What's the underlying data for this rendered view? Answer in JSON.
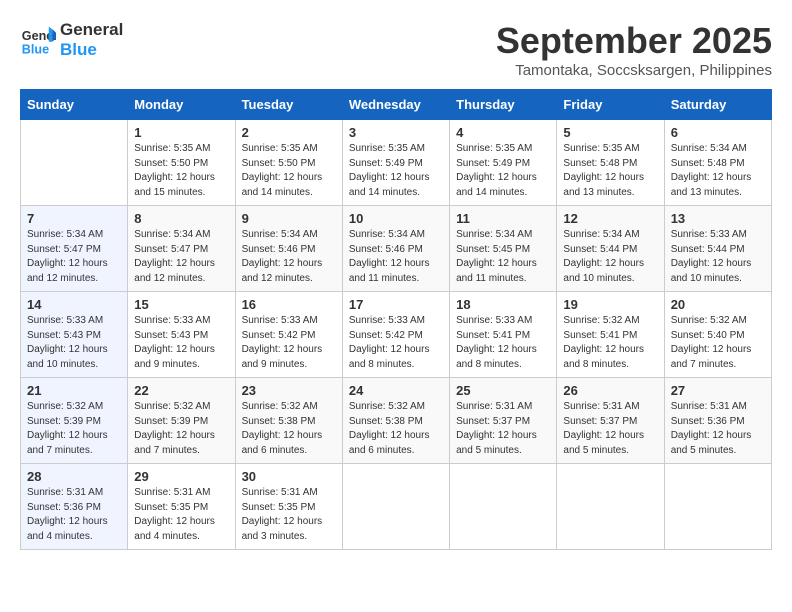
{
  "logo": {
    "line1": "General",
    "line2": "Blue"
  },
  "title": "September 2025",
  "location": "Tamontaka, Soccsksargen, Philippines",
  "weekdays": [
    "Sunday",
    "Monday",
    "Tuesday",
    "Wednesday",
    "Thursday",
    "Friday",
    "Saturday"
  ],
  "weeks": [
    [
      {
        "day": "",
        "detail": ""
      },
      {
        "day": "1",
        "detail": "Sunrise: 5:35 AM\nSunset: 5:50 PM\nDaylight: 12 hours\nand 15 minutes."
      },
      {
        "day": "2",
        "detail": "Sunrise: 5:35 AM\nSunset: 5:50 PM\nDaylight: 12 hours\nand 14 minutes."
      },
      {
        "day": "3",
        "detail": "Sunrise: 5:35 AM\nSunset: 5:49 PM\nDaylight: 12 hours\nand 14 minutes."
      },
      {
        "day": "4",
        "detail": "Sunrise: 5:35 AM\nSunset: 5:49 PM\nDaylight: 12 hours\nand 14 minutes."
      },
      {
        "day": "5",
        "detail": "Sunrise: 5:35 AM\nSunset: 5:48 PM\nDaylight: 12 hours\nand 13 minutes."
      },
      {
        "day": "6",
        "detail": "Sunrise: 5:34 AM\nSunset: 5:48 PM\nDaylight: 12 hours\nand 13 minutes."
      }
    ],
    [
      {
        "day": "7",
        "detail": "Sunrise: 5:34 AM\nSunset: 5:47 PM\nDaylight: 12 hours\nand 12 minutes."
      },
      {
        "day": "8",
        "detail": "Sunrise: 5:34 AM\nSunset: 5:47 PM\nDaylight: 12 hours\nand 12 minutes."
      },
      {
        "day": "9",
        "detail": "Sunrise: 5:34 AM\nSunset: 5:46 PM\nDaylight: 12 hours\nand 12 minutes."
      },
      {
        "day": "10",
        "detail": "Sunrise: 5:34 AM\nSunset: 5:46 PM\nDaylight: 12 hours\nand 11 minutes."
      },
      {
        "day": "11",
        "detail": "Sunrise: 5:34 AM\nSunset: 5:45 PM\nDaylight: 12 hours\nand 11 minutes."
      },
      {
        "day": "12",
        "detail": "Sunrise: 5:34 AM\nSunset: 5:44 PM\nDaylight: 12 hours\nand 10 minutes."
      },
      {
        "day": "13",
        "detail": "Sunrise: 5:33 AM\nSunset: 5:44 PM\nDaylight: 12 hours\nand 10 minutes."
      }
    ],
    [
      {
        "day": "14",
        "detail": "Sunrise: 5:33 AM\nSunset: 5:43 PM\nDaylight: 12 hours\nand 10 minutes."
      },
      {
        "day": "15",
        "detail": "Sunrise: 5:33 AM\nSunset: 5:43 PM\nDaylight: 12 hours\nand 9 minutes."
      },
      {
        "day": "16",
        "detail": "Sunrise: 5:33 AM\nSunset: 5:42 PM\nDaylight: 12 hours\nand 9 minutes."
      },
      {
        "day": "17",
        "detail": "Sunrise: 5:33 AM\nSunset: 5:42 PM\nDaylight: 12 hours\nand 8 minutes."
      },
      {
        "day": "18",
        "detail": "Sunrise: 5:33 AM\nSunset: 5:41 PM\nDaylight: 12 hours\nand 8 minutes."
      },
      {
        "day": "19",
        "detail": "Sunrise: 5:32 AM\nSunset: 5:41 PM\nDaylight: 12 hours\nand 8 minutes."
      },
      {
        "day": "20",
        "detail": "Sunrise: 5:32 AM\nSunset: 5:40 PM\nDaylight: 12 hours\nand 7 minutes."
      }
    ],
    [
      {
        "day": "21",
        "detail": "Sunrise: 5:32 AM\nSunset: 5:39 PM\nDaylight: 12 hours\nand 7 minutes."
      },
      {
        "day": "22",
        "detail": "Sunrise: 5:32 AM\nSunset: 5:39 PM\nDaylight: 12 hours\nand 7 minutes."
      },
      {
        "day": "23",
        "detail": "Sunrise: 5:32 AM\nSunset: 5:38 PM\nDaylight: 12 hours\nand 6 minutes."
      },
      {
        "day": "24",
        "detail": "Sunrise: 5:32 AM\nSunset: 5:38 PM\nDaylight: 12 hours\nand 6 minutes."
      },
      {
        "day": "25",
        "detail": "Sunrise: 5:31 AM\nSunset: 5:37 PM\nDaylight: 12 hours\nand 5 minutes."
      },
      {
        "day": "26",
        "detail": "Sunrise: 5:31 AM\nSunset: 5:37 PM\nDaylight: 12 hours\nand 5 minutes."
      },
      {
        "day": "27",
        "detail": "Sunrise: 5:31 AM\nSunset: 5:36 PM\nDaylight: 12 hours\nand 5 minutes."
      }
    ],
    [
      {
        "day": "28",
        "detail": "Sunrise: 5:31 AM\nSunset: 5:36 PM\nDaylight: 12 hours\nand 4 minutes."
      },
      {
        "day": "29",
        "detail": "Sunrise: 5:31 AM\nSunset: 5:35 PM\nDaylight: 12 hours\nand 4 minutes."
      },
      {
        "day": "30",
        "detail": "Sunrise: 5:31 AM\nSunset: 5:35 PM\nDaylight: 12 hours\nand 3 minutes."
      },
      {
        "day": "",
        "detail": ""
      },
      {
        "day": "",
        "detail": ""
      },
      {
        "day": "",
        "detail": ""
      },
      {
        "day": "",
        "detail": ""
      }
    ]
  ]
}
